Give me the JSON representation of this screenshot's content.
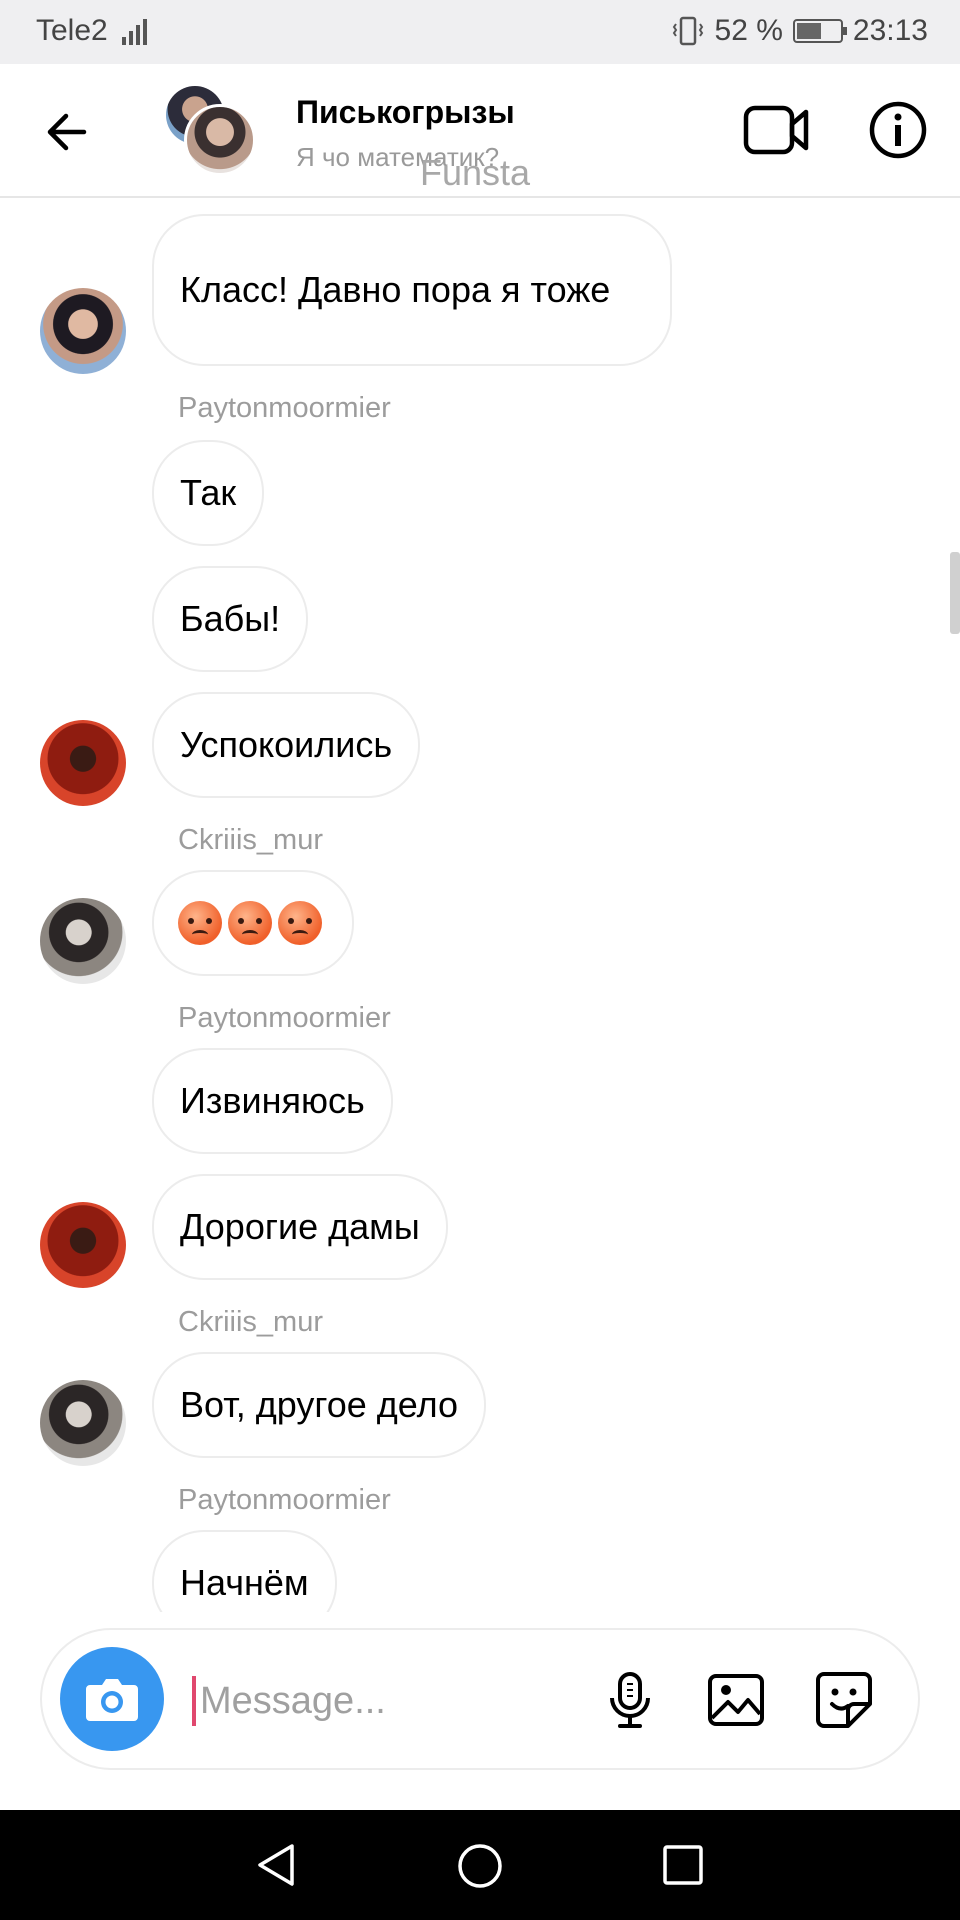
{
  "status_bar": {
    "carrier": "Tele2",
    "battery": "52 %",
    "time": "23:13"
  },
  "header": {
    "title": "Писькогрызы",
    "subtitle": "Я чо математик?",
    "watermark": "Funsta"
  },
  "messages": [
    {
      "type": "bubble",
      "text": "Класс!  Давно пора я тоже"
    },
    {
      "type": "sender",
      "text": "Paytonmoormier"
    },
    {
      "type": "bubble",
      "text": "Так"
    },
    {
      "type": "bubble",
      "text": "Бабы!"
    },
    {
      "type": "bubble",
      "text": "Успокоились"
    },
    {
      "type": "sender",
      "text": "Ckriiis_mur"
    },
    {
      "type": "bubble",
      "text": "😡😡😡"
    },
    {
      "type": "sender",
      "text": "Paytonmoormier"
    },
    {
      "type": "bubble",
      "text": "Извиняюсь"
    },
    {
      "type": "bubble",
      "text": "Дорогие дамы"
    },
    {
      "type": "sender",
      "text": "Ckriiis_mur"
    },
    {
      "type": "bubble",
      "text": "Вот, другое дело"
    },
    {
      "type": "sender",
      "text": "Paytonmoormier"
    },
    {
      "type": "bubble",
      "text": "Начнём"
    }
  ],
  "composer": {
    "placeholder": "Message..."
  },
  "icons": {
    "back": "arrow-left-icon",
    "video": "video-camera-icon",
    "info": "info-icon",
    "camera": "camera-icon",
    "mic": "microphone-icon",
    "gallery": "image-icon",
    "sticker": "sticker-icon"
  },
  "colors": {
    "accent": "#3897f0",
    "cursor": "#e0486e",
    "bubble_border": "#ececec",
    "secondary_text": "#9c9c9c"
  }
}
